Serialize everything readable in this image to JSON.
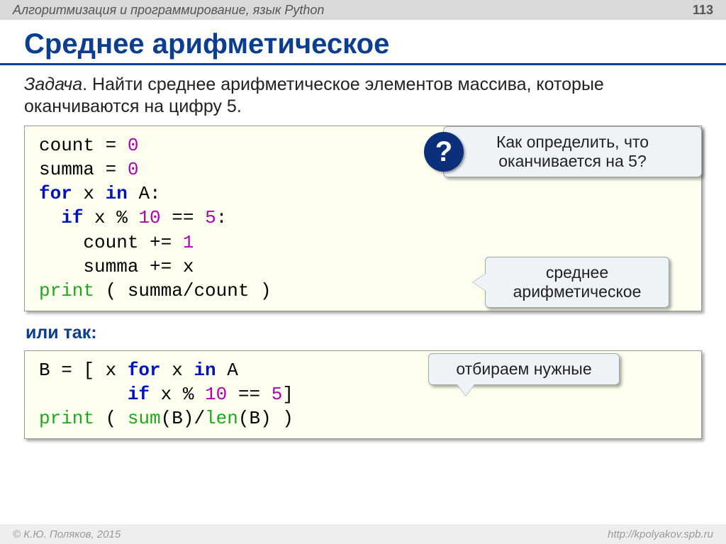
{
  "header": {
    "course_title": "Алгоритмизация и программирование, язык Python",
    "page_number": "113"
  },
  "title": "Среднее арифметическое",
  "task": {
    "lead": "Задача",
    "text": ". Найти среднее арифметическое элементов массива, которые оканчиваются на цифру 5."
  },
  "code1": {
    "l1a": "count",
    "l1b": " = ",
    "l1c": "0",
    "l2a": "summa",
    "l2b": " = ",
    "l2c": "0",
    "l3a": "for",
    "l3b": " x ",
    "l3c": "in",
    "l3d": " A:",
    "l4a": "  ",
    "l4b": "if",
    "l4c": " x % ",
    "l4d": "10",
    "l4e": " == ",
    "l4f": "5",
    "l4g": ":",
    "l5a": "    count += ",
    "l5b": "1",
    "l6a": "    summa += x",
    "l7a": "print",
    "l7b": " ( summa/count )"
  },
  "or_label": "или так:",
  "code2": {
    "l1a": "B = [ x ",
    "l1b": "for",
    "l1c": " x ",
    "l1d": "in",
    "l1e": " A",
    "l2a": "        ",
    "l2b": "if",
    "l2c": " x % ",
    "l2d": "10",
    "l2e": " == ",
    "l2f": "5",
    "l2g": "]",
    "l3a": "print",
    "l3b": " ( ",
    "l3c": "sum",
    "l3d": "(B)/",
    "l3e": "len",
    "l3f": "(B) )"
  },
  "callouts": {
    "question": "Как определить, что оканчивается на 5?",
    "mean": "среднее арифметическое",
    "filter": "отбираем нужные"
  },
  "footer": {
    "copyright": "© К.Ю. Поляков, 2015",
    "url": "http://kpolyakov.spb.ru"
  },
  "qmark": "?"
}
